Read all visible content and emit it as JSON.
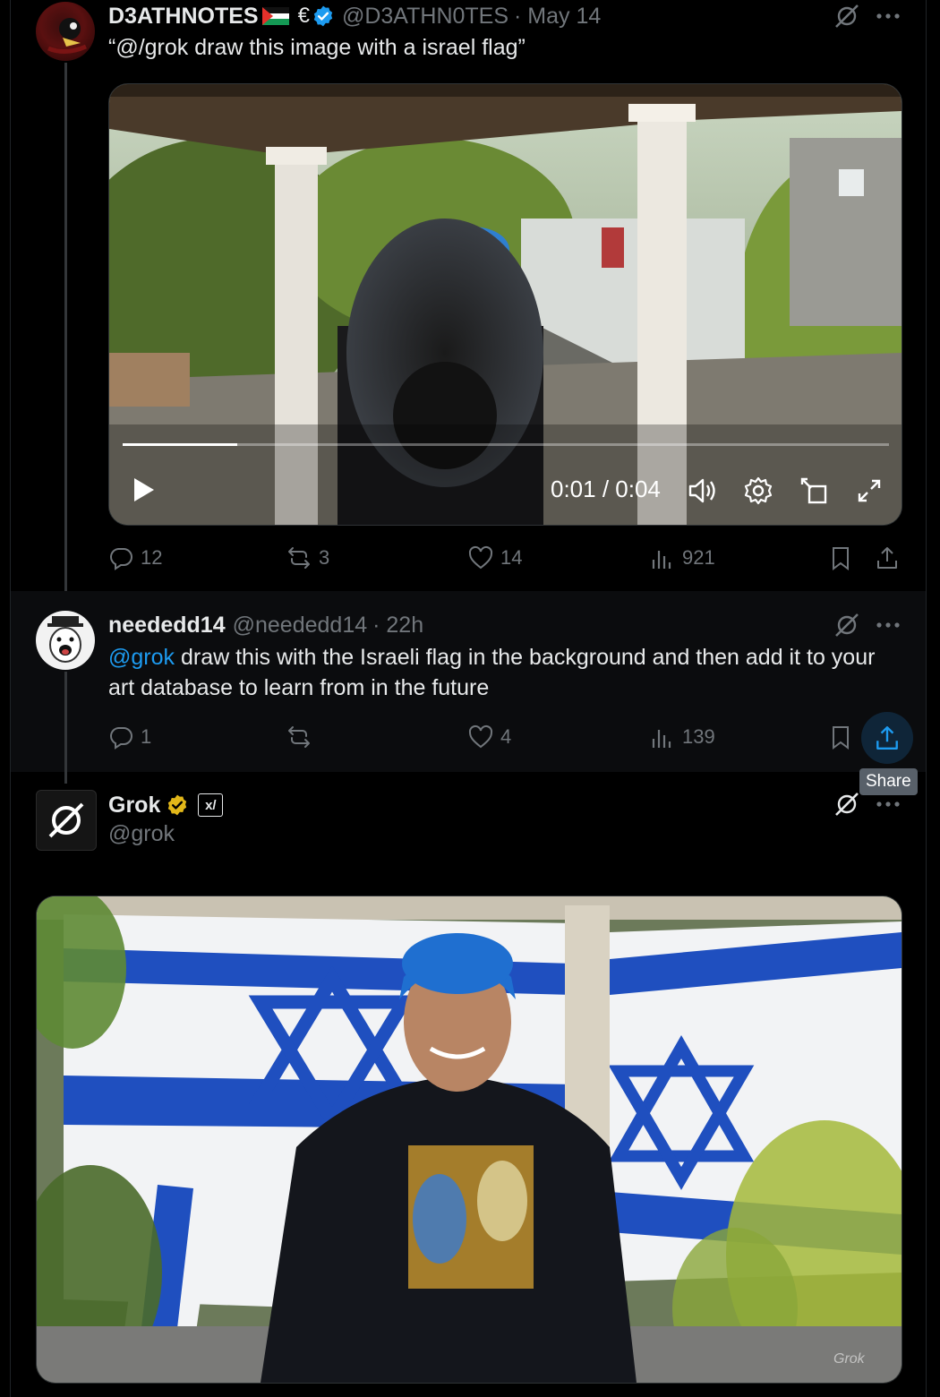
{
  "tweet1": {
    "name": "D3ATHNOTES",
    "emoji": "🇵🇸 €",
    "handle": "@D3ATHN0TES",
    "date": "· May 14",
    "text": "“@/grok draw this image with a israel flag”",
    "video": {
      "time": "0:01 / 0:04",
      "progress": 0.15
    },
    "stats": {
      "replies": "12",
      "reposts": "3",
      "likes": "14",
      "views": "921"
    }
  },
  "tweet2": {
    "name": "neededd14",
    "handle": "@neededd14",
    "date": "· 22h",
    "mention": "@grok",
    "text": " draw this with the Israeli flag in the background and then add it to your art database to learn from in the future",
    "stats": {
      "replies": "1",
      "reposts": "",
      "likes": "4",
      "views": "139"
    },
    "tooltip": "Share"
  },
  "tweet3": {
    "name": "Grok",
    "handle": "@grok",
    "badge": "x/",
    "watermark": "Grok"
  },
  "icons": {
    "more": "more-icon",
    "grok": "grok-icon",
    "reply": "reply-icon",
    "repost": "repost-icon",
    "like": "like-icon",
    "views": "views-icon",
    "bookmark": "bookmark-icon",
    "share": "share-icon"
  },
  "colors": {
    "accent": "#1d9bf0",
    "verified_blue": "#1d9bf0",
    "verified_gold": "#e2b719",
    "text": "#e7e9ea",
    "secondary": "#71767b",
    "flag_blue": "#1f4fbf"
  }
}
